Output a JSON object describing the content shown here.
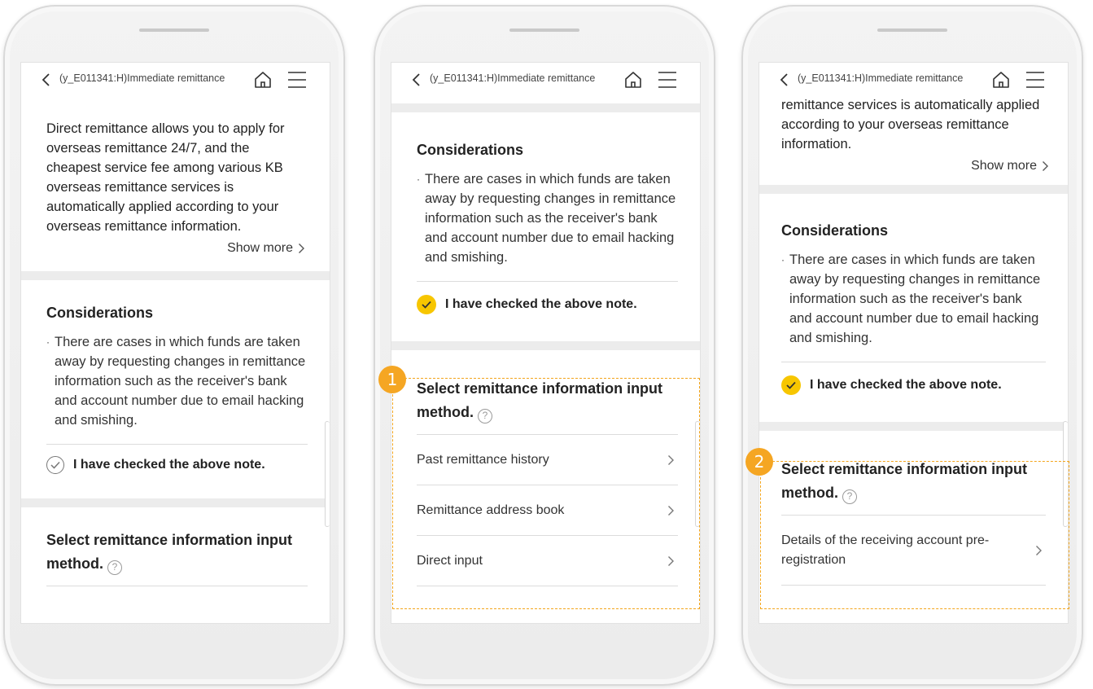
{
  "nav": {
    "title": "(y_E011341:H)Immediate remittance"
  },
  "intro": {
    "text_full": "Direct remittance allows you to apply for overseas remittance 24/7, and the cheapest service fee among various KB overseas remittance services is automatically applied according to your overseas remittance information.",
    "text_tail": "remittance services is automatically applied according to your overseas remittance information.",
    "show_more": "Show more"
  },
  "considerations": {
    "title": "Considerations",
    "bullet": "There are cases in which funds are taken away by requesting changes in remittance information such as the receiver's bank and account number due to email hacking and smishing.",
    "check_label": "I have checked the above note."
  },
  "select_method": {
    "title": "Select remittance information input method.",
    "help": "?",
    "options": [
      "Past remittance history",
      "Remittance address book",
      "Direct input"
    ],
    "option_preregistration": "Details of the receiving account pre-registration"
  },
  "badges": {
    "first": "1",
    "second": "2"
  },
  "colors": {
    "accent_yellow": "#f7c600",
    "highlight_orange": "#f3a51c",
    "badge_orange": "#f5a623"
  }
}
